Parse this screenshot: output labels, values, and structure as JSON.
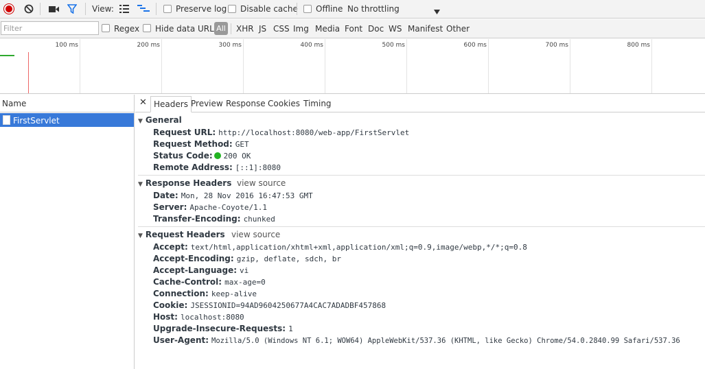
{
  "toolbar": {
    "view_label": "View:",
    "preserve_log": "Preserve log",
    "disable_cache": "Disable cache",
    "offline": "Offline",
    "throttling": "No throttling"
  },
  "filter_bar": {
    "placeholder": "Filter",
    "regex": "Regex",
    "hide_data_urls": "Hide data URLs",
    "types": [
      "All",
      "XHR",
      "JS",
      "CSS",
      "Img",
      "Media",
      "Font",
      "Doc",
      "WS",
      "Manifest",
      "Other"
    ]
  },
  "overview": {
    "ticks": [
      "100 ms",
      "200 ms",
      "300 ms",
      "400 ms",
      "500 ms",
      "600 ms",
      "700 ms",
      "800 ms"
    ]
  },
  "requests": {
    "column_name": "Name",
    "items": [
      {
        "name": "FirstServlet"
      }
    ]
  },
  "tabs": [
    "Headers",
    "Preview",
    "Response",
    "Cookies",
    "Timing"
  ],
  "general": {
    "title": "General",
    "items": [
      {
        "key": "Request URL:",
        "value": "http://localhost:8080/web-app/FirstServlet"
      },
      {
        "key": "Request Method:",
        "value": "GET"
      },
      {
        "key": "Status Code:",
        "value": "200 OK"
      },
      {
        "key": "Remote Address:",
        "value": "[::1]:8080"
      }
    ]
  },
  "response_headers": {
    "title": "Response Headers",
    "view_source": "view source",
    "items": [
      {
        "key": "Date:",
        "value": "Mon, 28 Nov 2016 16:47:53 GMT"
      },
      {
        "key": "Server:",
        "value": "Apache-Coyote/1.1"
      },
      {
        "key": "Transfer-Encoding:",
        "value": "chunked"
      }
    ]
  },
  "request_headers": {
    "title": "Request Headers",
    "view_source": "view source",
    "items": [
      {
        "key": "Accept:",
        "value": "text/html,application/xhtml+xml,application/xml;q=0.9,image/webp,*/*;q=0.8"
      },
      {
        "key": "Accept-Encoding:",
        "value": "gzip, deflate, sdch, br"
      },
      {
        "key": "Accept-Language:",
        "value": "vi"
      },
      {
        "key": "Cache-Control:",
        "value": "max-age=0"
      },
      {
        "key": "Connection:",
        "value": "keep-alive"
      },
      {
        "key": "Cookie:",
        "value": "JSESSIONID=94AD9604250677A4CAC7ADADBF457868"
      },
      {
        "key": "Host:",
        "value": "localhost:8080"
      },
      {
        "key": "Upgrade-Insecure-Requests:",
        "value": "1"
      },
      {
        "key": "User-Agent:",
        "value": "Mozilla/5.0 (Windows NT 6.1; WOW64) AppleWebKit/537.36 (KHTML, like Gecko) Chrome/54.0.2840.99 Safari/537.36"
      }
    ]
  },
  "colors": {
    "record": "#d00000",
    "filter_icon": "#1a73e8",
    "selected_row": "#3879d9",
    "status_ok": "#22b322"
  }
}
